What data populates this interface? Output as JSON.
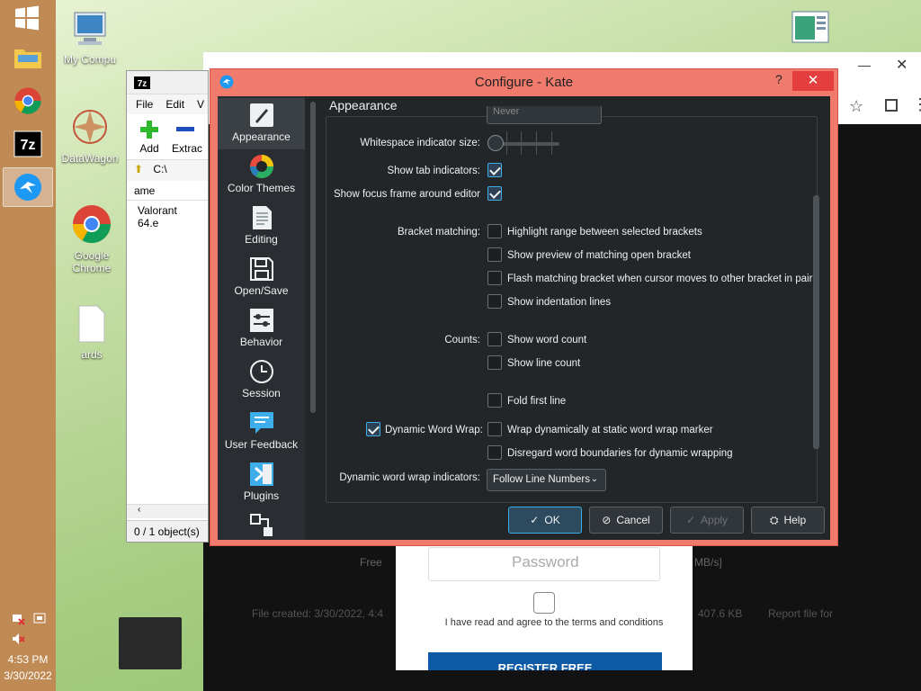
{
  "desktop": {
    "icons": [
      {
        "label": "My Compu"
      },
      {
        "label": "DataWagon"
      },
      {
        "label": "Google Chrome"
      },
      {
        "label": "ards"
      }
    ]
  },
  "taskbar": {
    "time": "4:53 PM",
    "date": "3/30/2022"
  },
  "browser": {
    "password_placeholder": "Password",
    "terms": "I have read and agree to the terms and conditions",
    "register": "REGISTER FREE",
    "file_created": "File created: 3/30/2022, 4:4",
    "file_size": "407.6 KB",
    "report": "Report file for",
    "free_label": "Free",
    "speed": "MB/s]"
  },
  "zip": {
    "menu": [
      "File",
      "Edit",
      "V"
    ],
    "tools": [
      {
        "label": "Add"
      },
      {
        "label": "Extrac"
      }
    ],
    "address": "C:\\",
    "column_header": "ame",
    "rows": [
      "Valorant 64.e"
    ],
    "status": "0 / 1 object(s)"
  },
  "kate": {
    "title": "Configure - Kate",
    "help_glyph": "?",
    "close_glyph": "✕",
    "page_title": "Appearance",
    "sidebar": [
      {
        "label": "Appearance"
      },
      {
        "label": "Color Themes"
      },
      {
        "label": "Editing"
      },
      {
        "label": "Open/Save"
      },
      {
        "label": "Behavior"
      },
      {
        "label": "Session"
      },
      {
        "label": "User Feedback"
      },
      {
        "label": "Plugins"
      }
    ],
    "partial_combo": "Never",
    "labels": {
      "whitespace_size": "Whitespace indicator size:",
      "show_tab": "Show tab indicators:",
      "focus_frame": "Show focus frame around editor",
      "bracket": "Bracket matching:",
      "counts": "Counts:",
      "dyn_wrap": "Dynamic Word Wrap:",
      "dyn_indicators": "Dynamic word wrap indicators:"
    },
    "options": {
      "highlight_range": "Highlight range between selected brackets",
      "preview_bracket": "Show preview of matching open bracket",
      "flash_bracket": "Flash matching bracket when cursor moves to other bracket in pair",
      "indent_lines": "Show indentation lines",
      "word_count": "Show word count",
      "line_count": "Show line count",
      "fold_first": "Fold first line",
      "wrap_static": "Wrap dynamically at static word wrap marker",
      "disregard": "Disregard word boundaries for dynamic wrapping"
    },
    "checked": {
      "show_tab": true,
      "focus_frame": true,
      "dyn_wrap": true,
      "highlight_range": false,
      "preview_bracket": false,
      "flash_bracket": false,
      "indent_lines": false,
      "word_count": false,
      "line_count": false,
      "fold_first": false,
      "wrap_static": false,
      "disregard": false
    },
    "wrap_indicator_value": "Follow Line Numbers",
    "buttons": {
      "ok": "OK",
      "cancel": "Cancel",
      "apply": "Apply",
      "help": "Help"
    },
    "colors": {
      "frame": "#f07a6c",
      "close": "#e53e3e",
      "dark_bg": "#232629",
      "accent": "#3daee9"
    }
  }
}
